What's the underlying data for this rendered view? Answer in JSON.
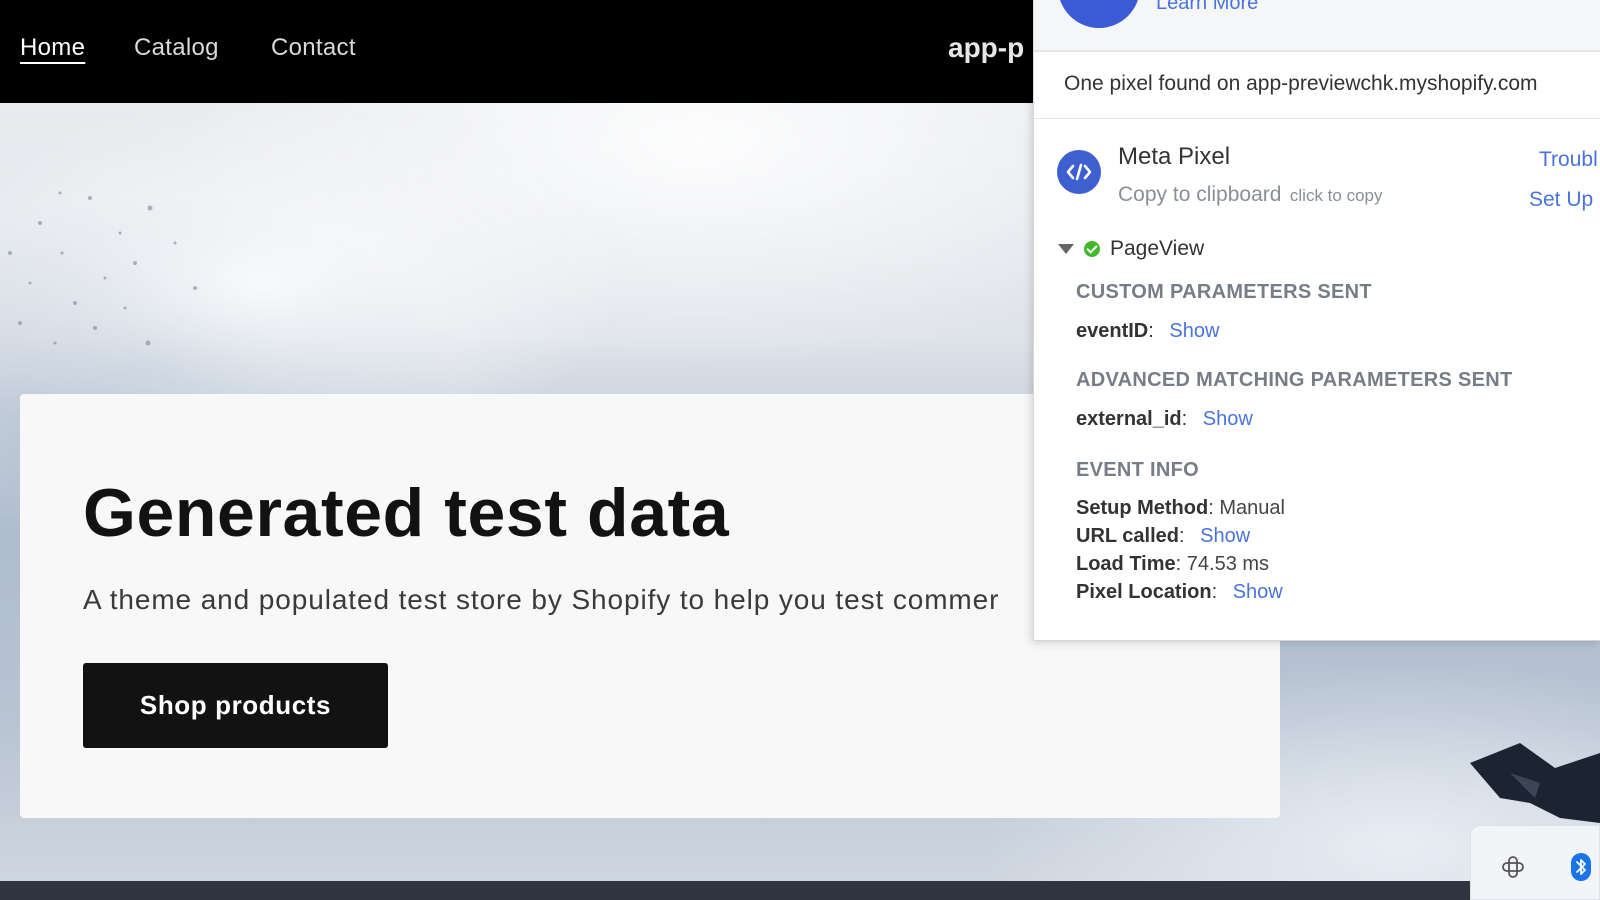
{
  "store": {
    "nav": [
      "Home",
      "Catalog",
      "Contact"
    ],
    "store_name": "app-p",
    "banner": {
      "title": "Generated test data",
      "subtitle": "A theme and populated test store by Shopify to help you test commer",
      "button_label": "Shop products"
    }
  },
  "popup": {
    "learn_more": "Learn More",
    "found_text": "One pixel found on app-previewchk.myshopify.com",
    "pixel": {
      "name": "Meta Pixel",
      "copy_label": "Copy to clipboard",
      "copy_hint": "click to copy",
      "trouble_label": "Troubl",
      "setup_label": "Set Up"
    },
    "event": {
      "name": "PageView",
      "status": "success",
      "custom_params_title": "CUSTOM PARAMETERS SENT",
      "custom_params": [
        {
          "key": "eventID",
          "sep": ":",
          "action": "Show"
        }
      ],
      "advanced_title": "ADVANCED MATCHING PARAMETERS SENT",
      "advanced_params": [
        {
          "key": "external_id",
          "sep": ":",
          "action": "Show"
        }
      ],
      "info_title": "EVENT INFO",
      "info": {
        "setup_method_key": "Setup Method",
        "setup_method_value": "Manual",
        "url_called_key": "URL called",
        "url_called_action": "Show",
        "load_time_key": "Load Time",
        "load_time_value": "74.53 ms",
        "pixel_location_key": "Pixel Location",
        "pixel_location_action": "Show"
      }
    }
  },
  "tray": {
    "icons": [
      "slack-icon",
      "bluetooth-icon"
    ]
  },
  "colors": {
    "link": "#4a74d9",
    "pixel_icon": "#3d5fd0",
    "success": "#42b72a",
    "button": "#121212"
  }
}
